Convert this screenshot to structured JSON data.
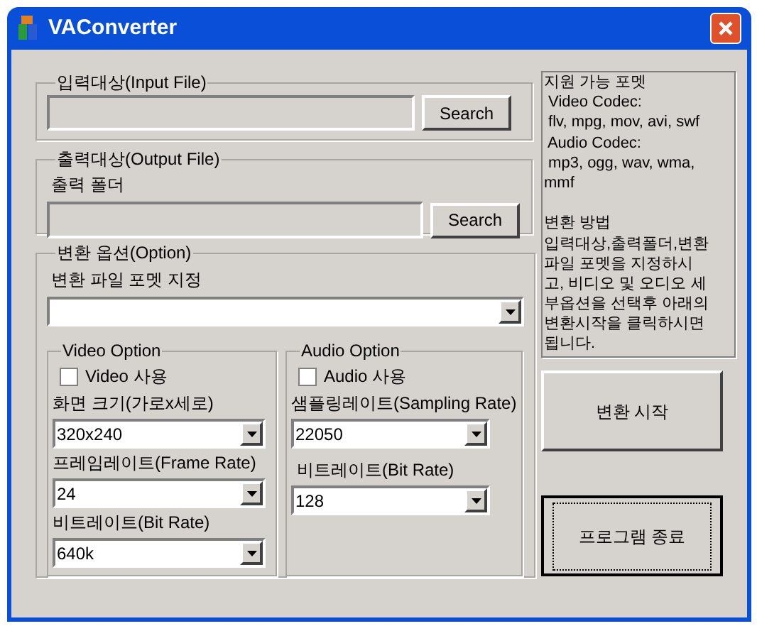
{
  "window": {
    "title": "VAConverter"
  },
  "input_group": {
    "label": "입력대상(Input File)",
    "button": "Search"
  },
  "output_group": {
    "label": "출력대상(Output File)",
    "folder_label": "출력 폴더",
    "button": "Search"
  },
  "options": {
    "label": "변환 옵션(Option)",
    "format_label": "변환 파일 포멧 지정",
    "video": {
      "label": "Video Option",
      "checkbox": {
        "label": "Video 사용",
        "checked": false
      },
      "fields": [
        {
          "label": "화면 크기(가로x세로)",
          "value": "320x240"
        },
        {
          "label": "프레임레이트(Frame Rate)",
          "value": "24"
        },
        {
          "label": "비트레이트(Bit Rate)",
          "value": "640k"
        }
      ]
    },
    "audio": {
      "label": "Audio Option",
      "checkbox": {
        "label": "Audio 사용",
        "checked": false
      },
      "fields": [
        {
          "label": "샘플링레이트(Sampling Rate)",
          "value": "22050"
        },
        {
          "label": "비트레이트(Bit Rate)",
          "value": "128"
        }
      ]
    }
  },
  "info": {
    "paragraphs": [
      [
        "지원 가능 포멧",
        " Video Codec:",
        " flv, mpg, mov, avi, swf",
        " Audio Codec:",
        " mp3, ogg, wav, wma,",
        "mmf"
      ],
      [
        "변환 방법",
        "입력대상,출력폴더,변환",
        "파일 포멧을 지정하시",
        "고, 비디오 및 오디오 세",
        "부옵션을 선택후 아래의",
        "변환시작을 클릭하시면",
        "됩니다."
      ]
    ]
  },
  "buttons": [
    {
      "label": "변환 시작",
      "focused": false
    },
    {
      "label": "프로그램 종료",
      "focused": true
    }
  ]
}
